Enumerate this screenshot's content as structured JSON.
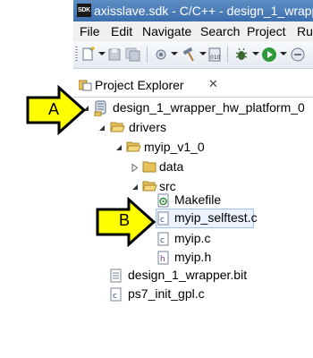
{
  "window": {
    "logo_text": "SDK",
    "title": "axisslave.sdk - C/C++ - design_1_wrapper_"
  },
  "menu": [
    "File",
    "Edit",
    "Navigate",
    "Search",
    "Project",
    "Ru"
  ],
  "explorer": {
    "tab_title": "Project Explorer",
    "close_glyph": "✕",
    "tree": {
      "project": "design_1_wrapper_hw_platform_0",
      "drivers": "drivers",
      "myip": "myip_v1_0",
      "data": "data",
      "src": "src",
      "makefile": "Makefile",
      "selftest": "myip_selftest.c",
      "myip_c": "myip.c",
      "myip_h": "myip.h",
      "bitfile": "design_1_wrapper.bit",
      "ps7": "ps7_init_gpl.c"
    }
  },
  "callouts": {
    "a": "A",
    "b": "B"
  },
  "colors": {
    "callout_fill": "#ffff00",
    "folder": "#e8c05a",
    "selection": "#eaf3fd",
    "titlebar": "#4b7cba"
  }
}
